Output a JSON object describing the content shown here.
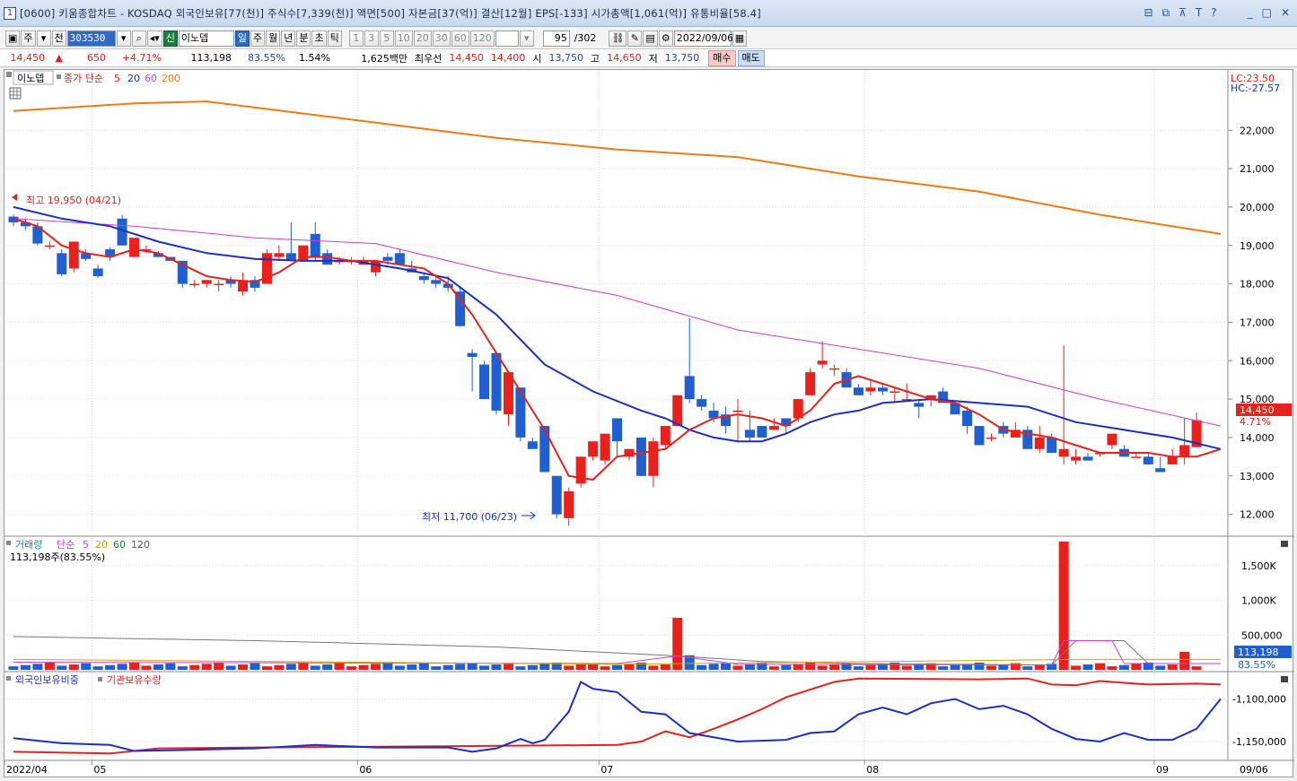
{
  "window": {
    "title": "[0600] 키움종합차트 - KOSDAQ 외국인보유[77(천)] 주식수[7,339(천)] 액면[500] 자본금[37(억)] 결산[12월] EPS[-133] 시가총액[1,061(억)] 유통비율[58.4]",
    "number": "1",
    "tool_icons": [
      "layout-icon",
      "restore-icon",
      "pin-icon",
      "text-icon",
      "help-icon"
    ],
    "window_icons": [
      "minimize-icon",
      "maximize-icon",
      "close-icon"
    ]
  },
  "toolbar": {
    "items": [
      "주",
      "전"
    ],
    "code": "303530",
    "name_badge": "신",
    "name": "이노뎁",
    "periods": [
      "일",
      "주",
      "월",
      "년",
      "분",
      "초",
      "틱"
    ],
    "selected_period": "일",
    "intervals": [
      "1",
      "3",
      "5",
      "10",
      "20",
      "30",
      "60",
      "120"
    ],
    "count": "95",
    "total": "/302",
    "date": "2022/09/06"
  },
  "info": {
    "price": "14,450",
    "arrow": "▲",
    "change": "650",
    "pct": "+4.71%",
    "volume": "113,198",
    "vol_pct": "83.55%",
    "turnover": "1.54%",
    "amount": "1,625백만",
    "best_label": "최우선",
    "ask": "14,450",
    "bid": "14,400",
    "open_label": "시",
    "open": "13,750",
    "high_label": "고",
    "high": "14,650",
    "low_label": "저",
    "low": "13,750",
    "buy": "매수",
    "sell": "매도"
  },
  "price_panel": {
    "legend_name": "이노뎁",
    "legend_ma": "종가 단순",
    "ma_periods": [
      "5",
      "20",
      "60",
      "200"
    ],
    "lc": "LC:23.50",
    "hc": "HC:-27.57",
    "high_note": "최고 19,950 (04/21)",
    "low_note": "최저 11,700 (06/23)",
    "price_tag": "14,450",
    "pct_tag": "4.71%",
    "yticks": [
      "22,000",
      "21,000",
      "20,000",
      "19,000",
      "18,000",
      "17,000",
      "16,000",
      "15,000",
      "14,000",
      "13,000",
      "12,000"
    ]
  },
  "volume_panel": {
    "legend_name": "거래량",
    "legend_ma": "단순",
    "ma_periods": [
      "5",
      "20",
      "60",
      "120"
    ],
    "sub": "113,198주(83.55%)",
    "yticks": [
      "1,500K",
      "1,000K",
      "500,000"
    ],
    "tag1": "113,198",
    "tag2": "83.55%"
  },
  "holding_panel": {
    "series1": "외국인보유비중",
    "series2": "기관보유수량",
    "yticks": [
      "-1,100,000",
      "-1,150,000"
    ]
  },
  "xaxis": {
    "labels": [
      "2022/04",
      "05",
      "06",
      "07",
      "08",
      "09",
      "09/06"
    ]
  },
  "colors": {
    "up": "#e8211c",
    "down": "#1f5fd0",
    "ma5": "#e8211c",
    "ma20": "#1a2fc8",
    "ma60": "#d23bd2",
    "ma200": "#f07a10"
  },
  "chart_data": {
    "type": "candlestick",
    "ylim": [
      11500,
      23500
    ],
    "candles": [
      [
        19750,
        19800,
        19500,
        19600
      ],
      [
        19600,
        19700,
        19400,
        19500
      ],
      [
        19500,
        19600,
        19000,
        19050
      ],
      [
        19000,
        19100,
        18900,
        19000
      ],
      [
        18800,
        18900,
        18200,
        18250
      ],
      [
        18400,
        19100,
        18300,
        19100
      ],
      [
        18800,
        18900,
        18600,
        18650
      ],
      [
        18400,
        18500,
        18150,
        18200
      ],
      [
        18900,
        18950,
        18600,
        18700
      ],
      [
        19700,
        19800,
        19000,
        19000
      ],
      [
        18700,
        19200,
        18700,
        19200
      ],
      [
        18900,
        19000,
        18800,
        18900
      ],
      [
        18800,
        18850,
        18700,
        18700
      ],
      [
        18700,
        18700,
        18600,
        18600
      ],
      [
        18600,
        18600,
        17900,
        18000
      ],
      [
        18000,
        18100,
        17900,
        18000
      ],
      [
        18000,
        18100,
        17900,
        18100
      ],
      [
        18000,
        18100,
        17800,
        18000
      ],
      [
        18100,
        18200,
        17900,
        18000
      ],
      [
        17800,
        18300,
        17700,
        18100
      ],
      [
        18100,
        18200,
        17800,
        17900
      ],
      [
        18000,
        18900,
        18000,
        18800
      ],
      [
        18700,
        19000,
        18600,
        18800
      ],
      [
        18800,
        19600,
        18600,
        18600
      ],
      [
        18600,
        19000,
        18600,
        19000
      ],
      [
        19300,
        19600,
        18600,
        18700
      ],
      [
        18800,
        18900,
        18500,
        18500
      ],
      [
        18600,
        18700,
        18500,
        18600
      ],
      [
        18600,
        18700,
        18500,
        18600
      ],
      [
        18500,
        18700,
        18500,
        18600
      ],
      [
        18300,
        18600,
        18200,
        18600
      ],
      [
        18700,
        18800,
        18500,
        18600
      ],
      [
        18800,
        18900,
        18500,
        18500
      ],
      [
        18400,
        18600,
        18300,
        18300
      ],
      [
        18200,
        18300,
        18000,
        18100
      ],
      [
        18100,
        18200,
        17900,
        18000
      ],
      [
        18000,
        18200,
        17800,
        17900
      ],
      [
        17800,
        17900,
        16900,
        16900
      ],
      [
        16200,
        16300,
        15200,
        16100
      ],
      [
        15900,
        16000,
        15200,
        15000
      ],
      [
        16200,
        16200,
        14600,
        14700
      ],
      [
        14600,
        15600,
        14300,
        15700
      ],
      [
        15300,
        15300,
        13900,
        14000
      ],
      [
        13900,
        14000,
        13700,
        13700
      ],
      [
        14300,
        14300,
        13100,
        13100
      ],
      [
        13000,
        13000,
        11900,
        12000
      ],
      [
        11900,
        12700,
        11700,
        12600
      ],
      [
        12800,
        13500,
        12700,
        13500
      ],
      [
        13500,
        13600,
        13400,
        13900
      ],
      [
        13400,
        14100,
        13300,
        14100
      ],
      [
        14500,
        14500,
        13500,
        13900
      ],
      [
        13500,
        13700,
        13400,
        13700
      ],
      [
        14000,
        14000,
        13000,
        13000
      ],
      [
        13000,
        14000,
        12700,
        13900
      ],
      [
        13800,
        14300,
        13700,
        14300
      ],
      [
        14300,
        15100,
        14300,
        15100
      ],
      [
        15600,
        17100,
        14900,
        15000
      ],
      [
        15000,
        15100,
        14700,
        14800
      ],
      [
        14700,
        14900,
        14400,
        14500
      ],
      [
        14600,
        14800,
        14100,
        14300
      ],
      [
        14700,
        15000,
        13900,
        14700
      ],
      [
        14200,
        14700,
        13900,
        14000
      ],
      [
        14300,
        14300,
        14000,
        14000
      ],
      [
        14200,
        14500,
        14200,
        14300
      ],
      [
        14500,
        14500,
        14100,
        14300
      ],
      [
        14500,
        15000,
        14400,
        15000
      ],
      [
        15100,
        15800,
        15100,
        15700
      ],
      [
        15900,
        16500,
        15800,
        16000
      ],
      [
        15800,
        15900,
        15600,
        15800
      ],
      [
        15700,
        15800,
        15300,
        15300
      ],
      [
        15300,
        15400,
        15100,
        15100
      ],
      [
        15200,
        15500,
        15100,
        15300
      ],
      [
        15300,
        15400,
        15100,
        15200
      ],
      [
        15200,
        15300,
        14900,
        15200
      ],
      [
        15000,
        15400,
        15000,
        15000
      ],
      [
        14900,
        15000,
        14500,
        14800
      ],
      [
        15000,
        15100,
        14800,
        15100
      ],
      [
        15200,
        15300,
        14900,
        14900
      ],
      [
        14900,
        14900,
        14700,
        14600
      ],
      [
        14700,
        14800,
        14100,
        14300
      ],
      [
        14300,
        14300,
        13800,
        13800
      ],
      [
        14000,
        14100,
        13900,
        14000
      ],
      [
        14300,
        14400,
        14000,
        14100
      ],
      [
        14000,
        14400,
        14000,
        14200
      ],
      [
        14200,
        14300,
        13700,
        13700
      ],
      [
        13700,
        14300,
        13600,
        14000
      ],
      [
        14000,
        14100,
        13600,
        13600
      ],
      [
        13500,
        16400,
        13300,
        13700
      ],
      [
        13400,
        13700,
        13300,
        13500
      ],
      [
        13500,
        13600,
        13400,
        13400
      ],
      [
        13600,
        13600,
        13500,
        13600
      ],
      [
        13800,
        14100,
        13700,
        14100
      ],
      [
        13700,
        13800,
        13500,
        13500
      ],
      [
        13500,
        13600,
        13500,
        13500
      ],
      [
        13500,
        13600,
        13300,
        13300
      ],
      [
        13200,
        13500,
        13100,
        13100
      ],
      [
        13300,
        13700,
        13300,
        13500
      ],
      [
        13500,
        14500,
        13300,
        13800
      ],
      [
        13750,
        14650,
        13750,
        14450
      ]
    ],
    "ma5": [
      [
        0,
        19700
      ],
      [
        2,
        19500
      ],
      [
        4,
        19000
      ],
      [
        6,
        18800
      ],
      [
        8,
        18700
      ],
      [
        10,
        18900
      ],
      [
        12,
        18800
      ],
      [
        14,
        18500
      ],
      [
        16,
        18200
      ],
      [
        18,
        18100
      ],
      [
        20,
        18050
      ],
      [
        22,
        18300
      ],
      [
        24,
        18700
      ],
      [
        26,
        18700
      ],
      [
        28,
        18600
      ],
      [
        30,
        18600
      ],
      [
        32,
        18500
      ],
      [
        34,
        18400
      ],
      [
        36,
        18000
      ],
      [
        38,
        17200
      ],
      [
        40,
        16200
      ],
      [
        42,
        15200
      ],
      [
        44,
        14200
      ],
      [
        46,
        13000
      ],
      [
        48,
        12900
      ],
      [
        50,
        13500
      ],
      [
        52,
        13600
      ],
      [
        54,
        13700
      ],
      [
        56,
        14200
      ],
      [
        58,
        14500
      ],
      [
        60,
        14600
      ],
      [
        62,
        14500
      ],
      [
        64,
        14300
      ],
      [
        66,
        14700
      ],
      [
        68,
        15400
      ],
      [
        70,
        15600
      ],
      [
        72,
        15400
      ],
      [
        74,
        15200
      ],
      [
        76,
        15000
      ],
      [
        78,
        14900
      ],
      [
        80,
        14600
      ],
      [
        82,
        14200
      ],
      [
        84,
        14100
      ],
      [
        86,
        14000
      ],
      [
        88,
        13800
      ],
      [
        90,
        13600
      ],
      [
        92,
        13600
      ],
      [
        94,
        13600
      ],
      [
        96,
        13500
      ],
      [
        98,
        13500
      ],
      [
        100,
        13700
      ]
    ],
    "ma20": [
      [
        0,
        20000
      ],
      [
        4,
        19700
      ],
      [
        8,
        19500
      ],
      [
        12,
        19100
      ],
      [
        16,
        18800
      ],
      [
        20,
        18650
      ],
      [
        24,
        18600
      ],
      [
        28,
        18600
      ],
      [
        32,
        18400
      ],
      [
        36,
        18150
      ],
      [
        40,
        17200
      ],
      [
        44,
        15900
      ],
      [
        48,
        15200
      ],
      [
        52,
        14700
      ],
      [
        54,
        14500
      ],
      [
        56,
        14200
      ],
      [
        58,
        14000
      ],
      [
        60,
        13900
      ],
      [
        62,
        13900
      ],
      [
        64,
        14100
      ],
      [
        66,
        14400
      ],
      [
        68,
        14600
      ],
      [
        70,
        14700
      ],
      [
        72,
        14900
      ],
      [
        76,
        15000
      ],
      [
        80,
        14900
      ],
      [
        84,
        14800
      ],
      [
        88,
        14400
      ],
      [
        92,
        14200
      ],
      [
        96,
        14000
      ],
      [
        100,
        13700
      ]
    ],
    "ma60": [
      [
        0,
        19700
      ],
      [
        10,
        19500
      ],
      [
        20,
        19200
      ],
      [
        30,
        19050
      ],
      [
        40,
        18300
      ],
      [
        50,
        17700
      ],
      [
        60,
        16800
      ],
      [
        70,
        16300
      ],
      [
        80,
        15800
      ],
      [
        90,
        15000
      ],
      [
        100,
        14300
      ]
    ],
    "ma200": [
      [
        0,
        22500
      ],
      [
        10,
        22700
      ],
      [
        16,
        22750
      ],
      [
        30,
        22200
      ],
      [
        40,
        21800
      ],
      [
        50,
        21500
      ],
      [
        60,
        21300
      ],
      [
        70,
        20800
      ],
      [
        80,
        20400
      ],
      [
        90,
        19800
      ],
      [
        100,
        19300
      ]
    ]
  }
}
